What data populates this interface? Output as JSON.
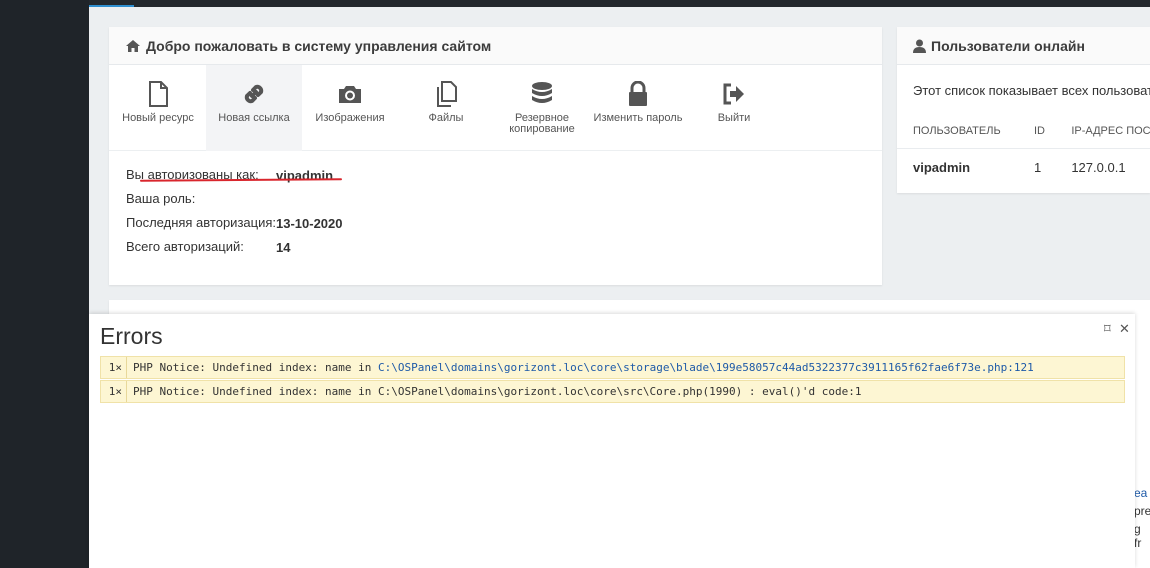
{
  "welcome": {
    "title": "Добро пожаловать в систему управления сайтом",
    "shortcuts": [
      {
        "label": "Новый ресурс",
        "icon": "file-icon"
      },
      {
        "label": "Новая ссылка",
        "icon": "link-icon"
      },
      {
        "label": "Изображения",
        "icon": "camera-icon"
      },
      {
        "label": "Файлы",
        "icon": "files-icon"
      },
      {
        "label": "Резервное копирование",
        "icon": "database-icon"
      },
      {
        "label": "Изменить пароль",
        "icon": "lock-icon"
      },
      {
        "label": "Выйти",
        "icon": "sign-out-icon"
      }
    ],
    "info": [
      {
        "label": "Вы авторизованы как:",
        "value": "vipadmin"
      },
      {
        "label": "Ваша роль:",
        "value": ""
      },
      {
        "label": "Последняя авторизация:",
        "value": "13-10-2020"
      },
      {
        "label": "Всего авторизаций:",
        "value": "14"
      }
    ]
  },
  "online": {
    "title": "Пользователи онлайн",
    "description": "Этот список показывает всех пользовате",
    "columns": [
      "ПОЛЬЗОВАТЕЛЬ",
      "ID",
      "IP-АДРЕС ПОС"
    ],
    "rows": [
      {
        "user": "vipadmin",
        "id": "1",
        "ip": "127.0.0.1"
      }
    ]
  },
  "lower_peek": {
    "line1": "ea",
    "line2": "pre",
    "line3": "g fr"
  },
  "errors": {
    "title": "Errors",
    "items": [
      {
        "count": "1×",
        "message": "PHP Notice: Undefined index: name in ",
        "path": "C:\\OSPanel\\domains\\gorizont.loc\\core\\storage\\blade\\199e58057c44ad5322377c3911165f62fae6f73e.php",
        "suffix": ":121"
      },
      {
        "count": "1×",
        "message": "PHP Notice: Undefined index: name in C:\\OSPanel\\domains\\gorizont.loc\\core\\src\\Core.php(1990) : eval()'d code:1",
        "path": "",
        "suffix": ""
      }
    ]
  },
  "colors": {
    "sidebar": "#1f2429",
    "accent": "#2e8fd0",
    "error_bg": "#fdf6d3",
    "underline": "#d9262d"
  }
}
